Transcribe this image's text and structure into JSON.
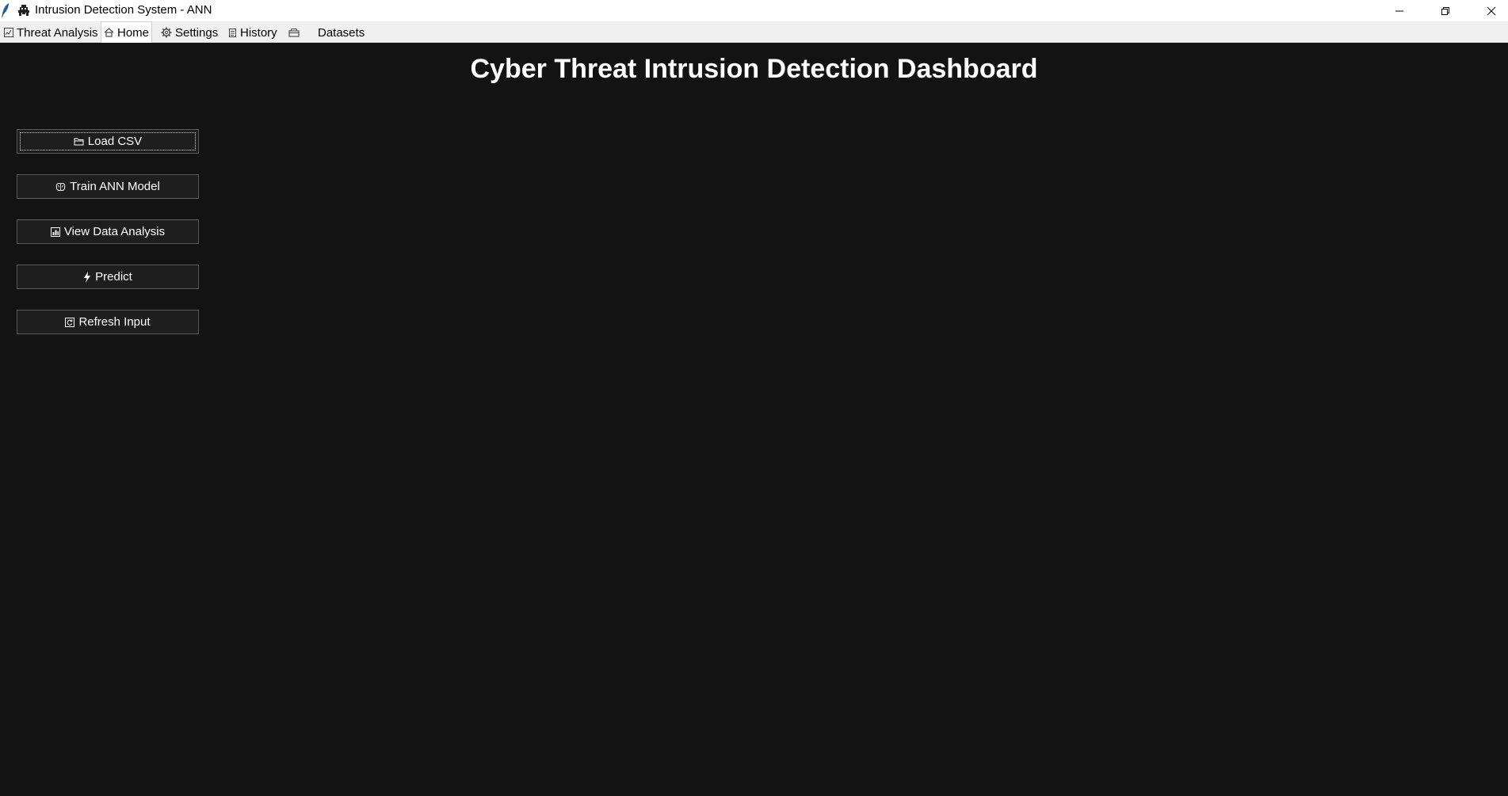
{
  "window": {
    "title": "Intrusion Detection System - ANN",
    "app_icon": "feather-icon",
    "title_icon": "alien-invader-icon",
    "controls": [
      "minimize-icon",
      "restore-icon",
      "close-icon"
    ]
  },
  "tabs": [
    {
      "label": "Threat Analysis",
      "icon": "chart-icon",
      "active": false
    },
    {
      "label": "Home",
      "icon": "house-icon",
      "active": true
    },
    {
      "label": "Settings",
      "icon": "gear-icon",
      "active": false
    },
    {
      "label": "History",
      "icon": "scroll-icon",
      "active": false
    },
    {
      "label": "",
      "icon": "card-box-icon",
      "active": false
    },
    {
      "label": "Datasets",
      "icon": "",
      "active": false
    }
  ],
  "main": {
    "title": "Cyber Threat Intrusion Detection Dashboard",
    "buttons": [
      {
        "label": "Load CSV",
        "icon": "folder-icon",
        "focused": true
      },
      {
        "label": "Train ANN Model",
        "icon": "brain-icon",
        "focused": false
      },
      {
        "label": "View Data Analysis",
        "icon": "bar-chart-icon",
        "focused": false
      },
      {
        "label": "Predict",
        "icon": "lightning-icon",
        "focused": false
      },
      {
        "label": "Refresh Input",
        "icon": "refresh-icon",
        "focused": false
      }
    ]
  },
  "colors": {
    "background": "#131313",
    "button_bg": "#1e1e1e",
    "button_border": "#5a5a5a",
    "text": "#ffffff",
    "tabbar_bg": "#f0f0f0"
  }
}
